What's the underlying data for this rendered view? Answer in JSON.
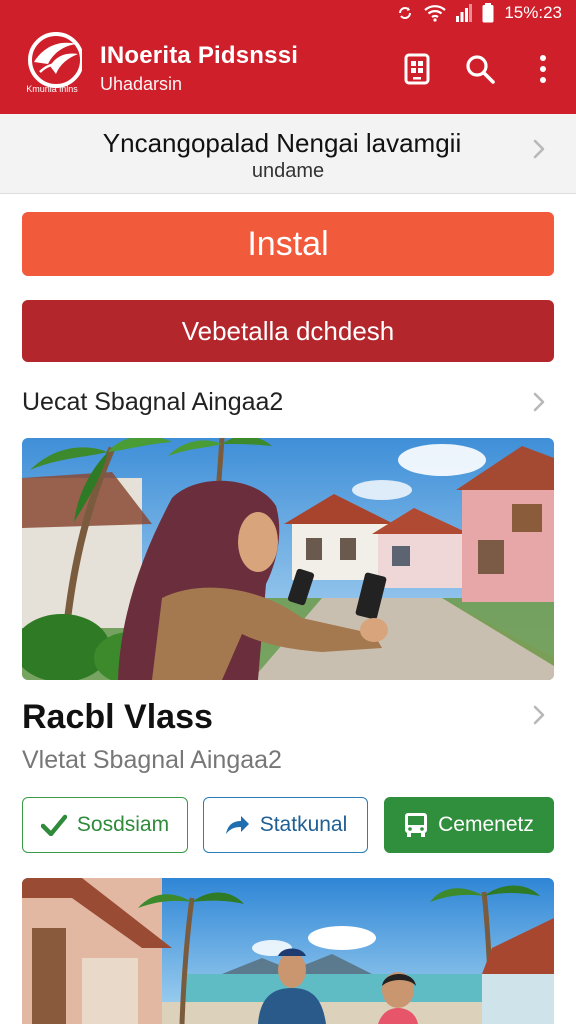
{
  "status": {
    "time": "15%:23"
  },
  "header": {
    "logo_text": "Kmunia lnlns",
    "title": "INoerita Pidsnssi",
    "subtitle": "Uhadarsin",
    "icons": [
      "app-list-icon",
      "search-icon",
      "more-vertical-icon"
    ]
  },
  "subheader": {
    "title": "Yncangopalad Nengai lavamgii",
    "subtitle": "undame"
  },
  "buttons": {
    "install": "Instal",
    "web": "Vebetalla dchdesh"
  },
  "link_row": {
    "label": "Uecat Sbagnal Aingaa2"
  },
  "card": {
    "title": "Racbl Vlass",
    "subtitle": "Vletat Sbagnal Aingaa2",
    "actions": [
      {
        "label": "Sosdsiam",
        "icon": "check-icon"
      },
      {
        "label": "Statkunal",
        "icon": "share-icon"
      },
      {
        "label": "Cemenetz",
        "icon": "bus-icon"
      }
    ]
  },
  "colors": {
    "header_red": "#cf1f2a",
    "install_orange": "#f25a3c",
    "web_red": "#b3262b",
    "green": "#2f8f3c",
    "blue": "#2b7cb8"
  }
}
